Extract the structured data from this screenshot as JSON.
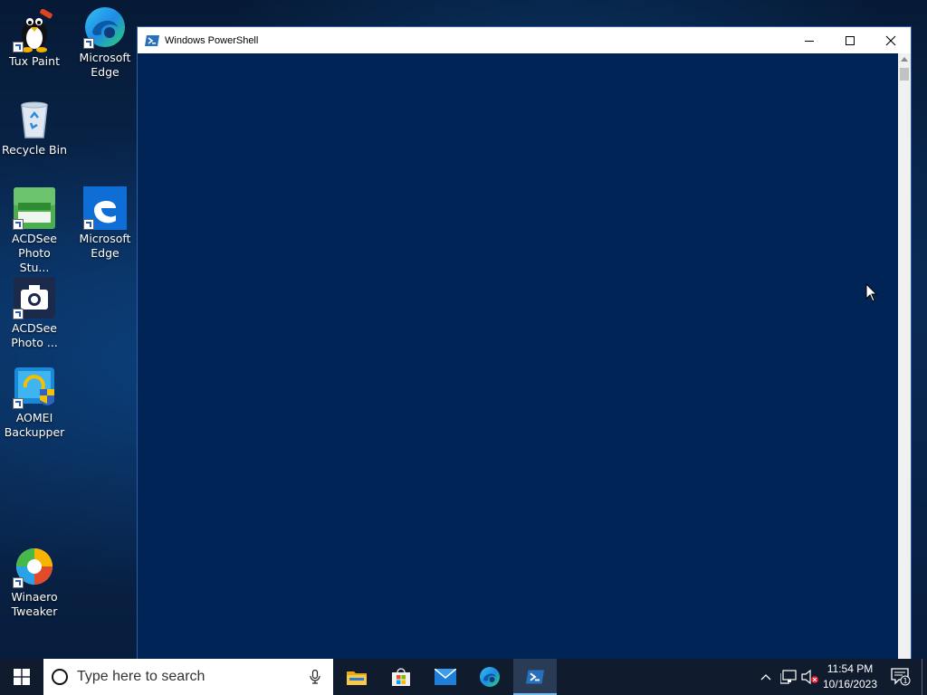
{
  "desktop": {
    "icons": [
      {
        "label": "Tux Paint"
      },
      {
        "label": "Microsoft Edge"
      },
      {
        "label": "Recycle Bin"
      },
      {
        "label": "ACDSee Photo Stu..."
      },
      {
        "label": "Microsoft Edge"
      },
      {
        "label": "ACDSee Photo ..."
      },
      {
        "label": "AOMEI Backupper"
      },
      {
        "label": "Winaero Tweaker"
      }
    ]
  },
  "window": {
    "title": "Windows PowerShell",
    "icon": "powershell-icon",
    "console_background": "#012456"
  },
  "taskbar": {
    "search_placeholder": "Type here to search",
    "apps": [
      {
        "name": "file-explorer-icon"
      },
      {
        "name": "microsoft-store-icon"
      },
      {
        "name": "mail-icon"
      },
      {
        "name": "edge-icon"
      },
      {
        "name": "powershell-icon",
        "active": true
      }
    ],
    "clock": {
      "time": "11:54 PM",
      "date": "10/16/2023"
    },
    "notification_count": "1"
  }
}
